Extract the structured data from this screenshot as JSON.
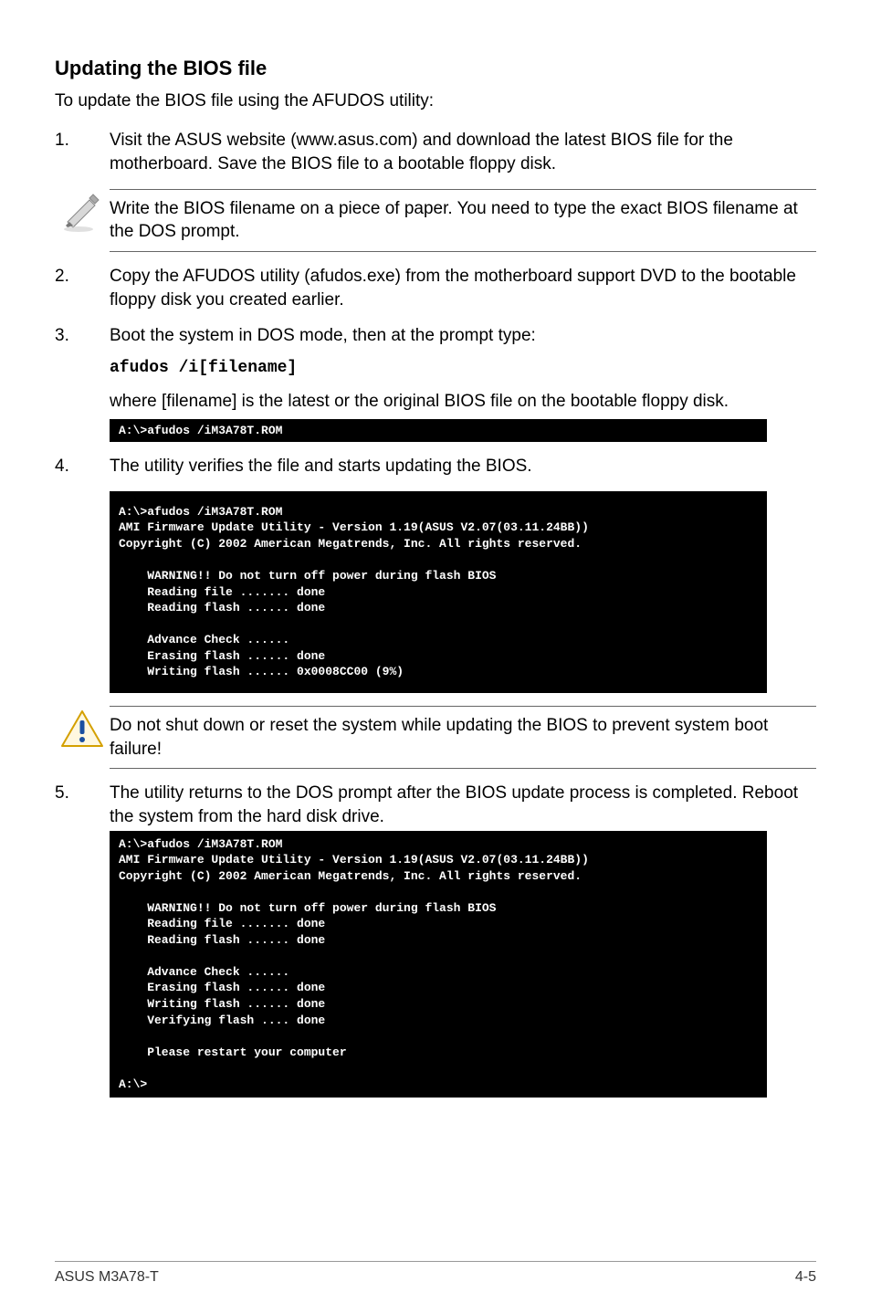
{
  "heading": "Updating the BIOS file",
  "intro": "To update the BIOS file using the AFUDOS utility:",
  "steps": {
    "s1": {
      "num": "1.",
      "text": "Visit the ASUS website (www.asus.com) and download the latest BIOS file for the motherboard. Save the BIOS file to a bootable floppy disk."
    },
    "s2": {
      "num": "2.",
      "text": "Copy the AFUDOS utility (afudos.exe) from the motherboard support DVD to the bootable floppy disk you created earlier."
    },
    "s3": {
      "num": "3.",
      "text": "Boot the system in DOS mode, then at the prompt type:"
    },
    "s3b": "where [filename] is the latest or the original BIOS file on the bootable floppy disk.",
    "s4": {
      "num": "4.",
      "text": "The utility verifies the file and starts updating the BIOS."
    },
    "s5": {
      "num": "5.",
      "text": "The utility returns to the DOS prompt after the BIOS update process is completed. Reboot the system from the hard disk drive."
    }
  },
  "note1": "Write the BIOS filename on a piece of paper. You need to type the exact BIOS filename at the DOS prompt.",
  "note2": "Do not shut down or reset the system while updating the BIOS to prevent system boot failure!",
  "cmd1": "afudos /i[filename]",
  "term1": "A:\\>afudos /iM3A78T.ROM",
  "term2": "A:\\>afudos /iM3A78T.ROM\nAMI Firmware Update Utility - Version 1.19(ASUS V2.07(03.11.24BB))\nCopyright (C) 2002 American Megatrends, Inc. All rights reserved.\n\n    WARNING!! Do not turn off power during flash BIOS\n    Reading file ....... done\n    Reading flash ...... done\n\n    Advance Check ......\n    Erasing flash ...... done\n    Writing flash ...... 0x0008CC00 (9%)",
  "term3": "A:\\>afudos /iM3A78T.ROM\nAMI Firmware Update Utility - Version 1.19(ASUS V2.07(03.11.24BB))\nCopyright (C) 2002 American Megatrends, Inc. All rights reserved.\n\n    WARNING!! Do not turn off power during flash BIOS\n    Reading file ....... done\n    Reading flash ...... done\n\n    Advance Check ......\n    Erasing flash ...... done\n    Writing flash ...... done\n    Verifying flash .... done\n\n    Please restart your computer\n\nA:\\>",
  "footer": {
    "left": "ASUS M3A78-T",
    "right": "4-5"
  }
}
